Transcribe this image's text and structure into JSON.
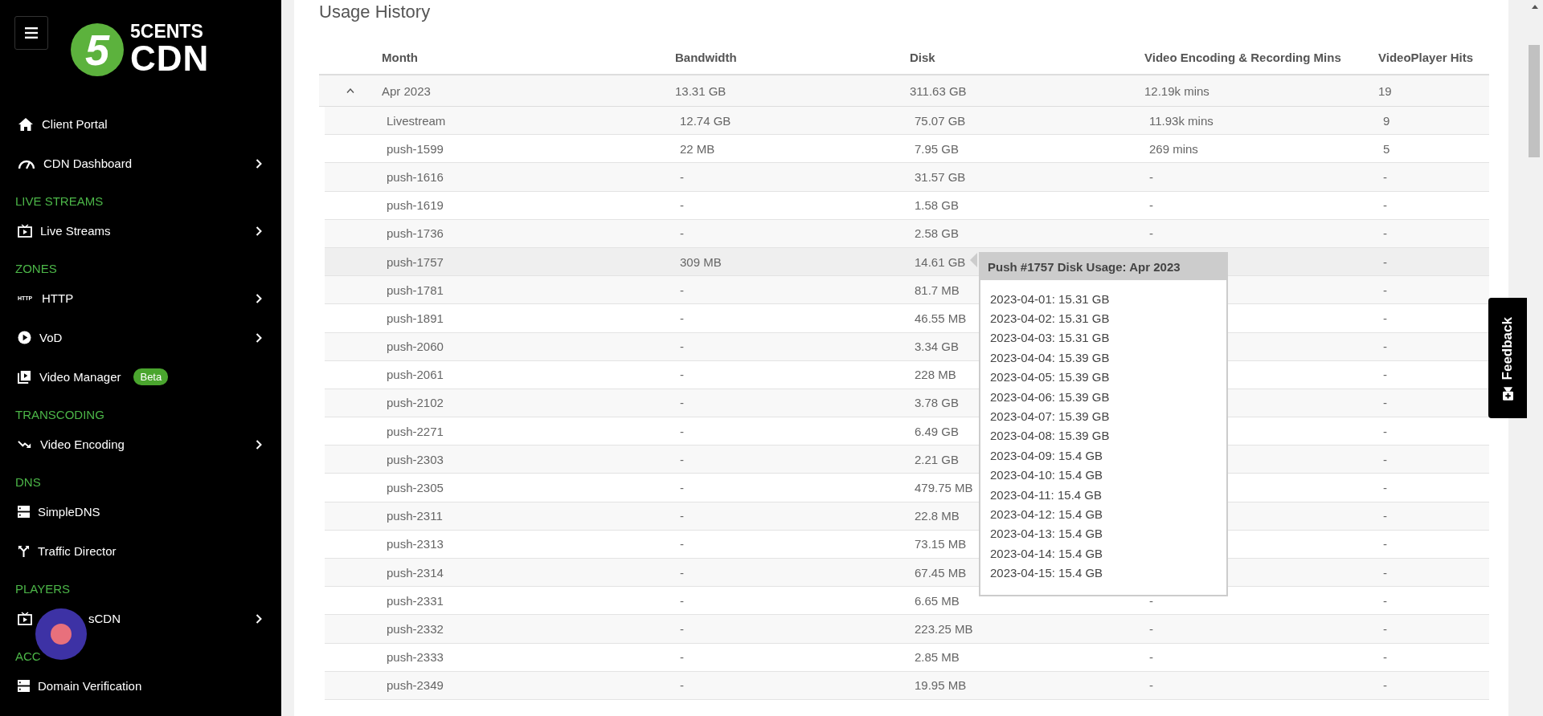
{
  "sidebar": {
    "logo": {
      "mark": "5",
      "line1": "5CENTS",
      "line2": "CDN"
    },
    "items": [
      {
        "kind": "link",
        "label": "Client Portal",
        "has_submenu": false,
        "covered": false
      },
      {
        "kind": "link",
        "label": "CDN Dashboard",
        "has_submenu": true,
        "covered": false
      },
      {
        "kind": "section",
        "label": "LIVE STREAMS"
      },
      {
        "kind": "link",
        "label": "Live Streams",
        "has_submenu": true,
        "covered": false
      },
      {
        "kind": "section",
        "label": "ZONES"
      },
      {
        "kind": "link",
        "label": "HTTP",
        "icon_text": "HTTP",
        "has_submenu": true,
        "covered": false
      },
      {
        "kind": "link",
        "label": "VoD",
        "has_submenu": true,
        "covered": false
      },
      {
        "kind": "link",
        "label": "Video Manager",
        "badge": "Beta",
        "has_submenu": false,
        "covered": false
      },
      {
        "kind": "section",
        "label": "TRANSCODING"
      },
      {
        "kind": "link",
        "label": "Video Encoding",
        "has_submenu": true,
        "covered": false
      },
      {
        "kind": "section",
        "label": "DNS"
      },
      {
        "kind": "link",
        "label": "SimpleDNS",
        "has_submenu": false,
        "covered": false
      },
      {
        "kind": "link",
        "label": "Traffic Director",
        "has_submenu": false,
        "covered": false
      },
      {
        "kind": "section",
        "label": "PLAYERS"
      },
      {
        "kind": "link",
        "label": "sCDN",
        "has_submenu": true,
        "covered": true
      },
      {
        "kind": "section",
        "label": "ACC"
      },
      {
        "kind": "link",
        "label": "Domain Verification",
        "has_submenu": false,
        "covered": false
      }
    ]
  },
  "page_title": "Usage History",
  "table": {
    "columns": [
      "Month",
      "Bandwidth",
      "Disk",
      "Video Encoding & Recording Mins",
      "VideoPlayer Hits"
    ],
    "groups": [
      {
        "expanded": true,
        "month": "Apr 2023",
        "bandwidth": "13.31 GB",
        "disk": "311.63 GB",
        "encoding": "12.19k mins",
        "hits": "19",
        "children": [
          {
            "name": "Livestream",
            "bandwidth": "12.74 GB",
            "disk": "75.07 GB",
            "encoding": "11.93k mins",
            "hits": "9",
            "hovered": false
          },
          {
            "name": "push-1599",
            "bandwidth": "22 MB",
            "disk": "7.95 GB",
            "encoding": "269 mins",
            "hits": "5",
            "hovered": false
          },
          {
            "name": "push-1616",
            "bandwidth": "-",
            "disk": "31.57 GB",
            "encoding": "-",
            "hits": "-",
            "hovered": false
          },
          {
            "name": "push-1619",
            "bandwidth": "-",
            "disk": "1.58 GB",
            "encoding": "-",
            "hits": "-",
            "hovered": false
          },
          {
            "name": "push-1736",
            "bandwidth": "-",
            "disk": "2.58 GB",
            "encoding": "-",
            "hits": "-",
            "hovered": false
          },
          {
            "name": "push-1757",
            "bandwidth": "309 MB",
            "disk": "14.61 GB",
            "hits": "-",
            "hovered": true
          },
          {
            "name": "push-1781",
            "bandwidth": "-",
            "disk": "81.7 MB",
            "hits": "-",
            "hovered": false
          },
          {
            "name": "push-1891",
            "bandwidth": "-",
            "disk": "46.55 MB",
            "hits": "-",
            "hovered": false
          },
          {
            "name": "push-2060",
            "bandwidth": "-",
            "disk": "3.34 GB",
            "hits": "-",
            "hovered": false
          },
          {
            "name": "push-2061",
            "bandwidth": "-",
            "disk": "228 MB",
            "hits": "-",
            "hovered": false
          },
          {
            "name": "push-2102",
            "bandwidth": "-",
            "disk": "3.78 GB",
            "hits": "-",
            "hovered": false
          },
          {
            "name": "push-2271",
            "bandwidth": "-",
            "disk": "6.49 GB",
            "hits": "-",
            "hovered": false
          },
          {
            "name": "push-2303",
            "bandwidth": "-",
            "disk": "2.21 GB",
            "hits": "-",
            "hovered": false
          },
          {
            "name": "push-2305",
            "bandwidth": "-",
            "disk": "479.75 MB",
            "hits": "-",
            "hovered": false
          },
          {
            "name": "push-2311",
            "bandwidth": "-",
            "disk": "22.8 MB",
            "hits": "-",
            "hovered": false
          },
          {
            "name": "push-2313",
            "bandwidth": "-",
            "disk": "73.15 MB",
            "hits": "-",
            "hovered": false
          },
          {
            "name": "push-2314",
            "bandwidth": "-",
            "disk": "67.45 MB",
            "hits": "-",
            "hovered": false
          },
          {
            "name": "push-2331",
            "bandwidth": "-",
            "disk": "6.65 MB",
            "encoding": "-",
            "hits": "-",
            "hovered": false
          },
          {
            "name": "push-2332",
            "bandwidth": "-",
            "disk": "223.25 MB",
            "encoding": "-",
            "hits": "-",
            "hovered": false
          },
          {
            "name": "push-2333",
            "bandwidth": "-",
            "disk": "2.85 MB",
            "encoding": "-",
            "hits": "-",
            "hovered": false
          },
          {
            "name": "push-2349",
            "bandwidth": "-",
            "disk": "19.95 MB",
            "encoding": "-",
            "hits": "-",
            "hovered": false
          }
        ]
      }
    ]
  },
  "tooltip": {
    "title": "Push #1757 Disk Usage: Apr 2023",
    "lines": [
      "2023-04-01: 15.31 GB",
      "2023-04-02: 15.31 GB",
      "2023-04-03: 15.31 GB",
      "2023-04-04: 15.39 GB",
      "2023-04-05: 15.39 GB",
      "2023-04-06: 15.39 GB",
      "2023-04-07: 15.39 GB",
      "2023-04-08: 15.39 GB",
      "2023-04-09: 15.4 GB",
      "2023-04-10: 15.4 GB",
      "2023-04-11: 15.4 GB",
      "2023-04-12: 15.4 GB",
      "2023-04-13: 15.4 GB",
      "2023-04-14: 15.4 GB",
      "2023-04-15: 15.4 GB"
    ]
  },
  "feedback": {
    "label": "Feedback"
  }
}
